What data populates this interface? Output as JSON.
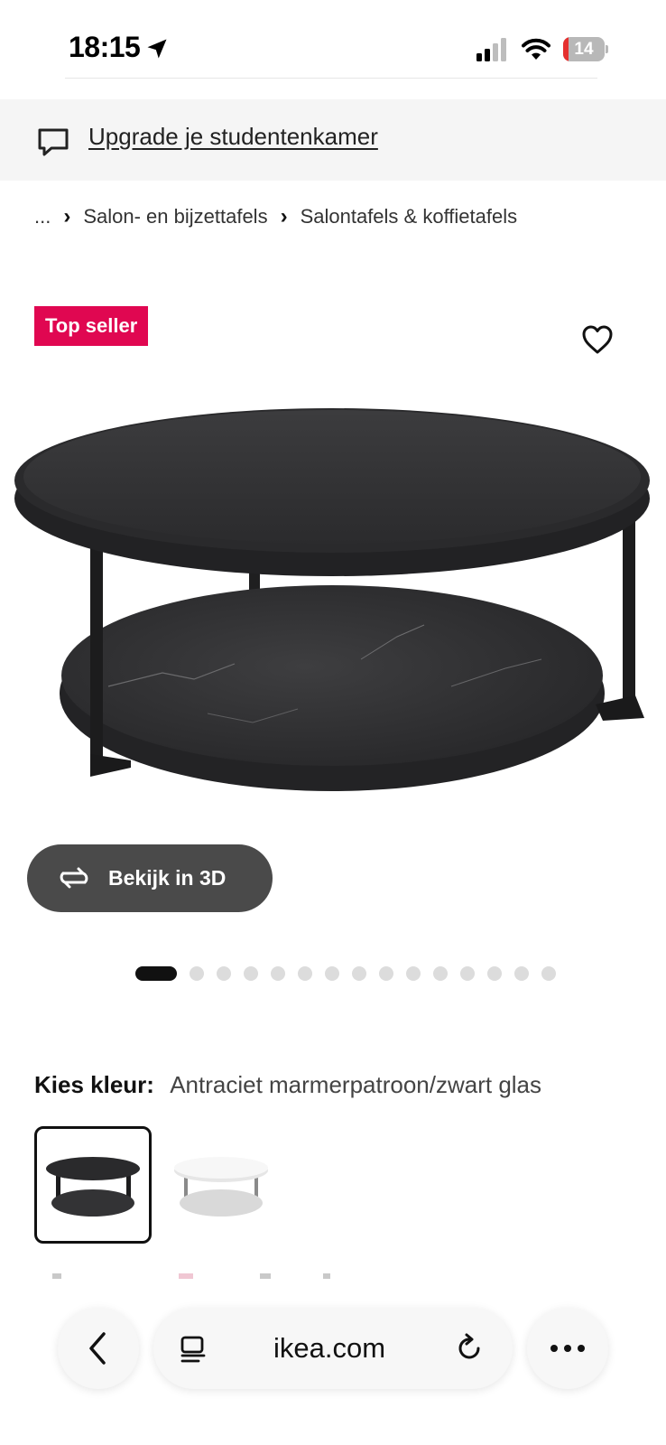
{
  "status_bar": {
    "time": "18:15",
    "battery_level": "14",
    "icons": [
      "location-arrow-icon",
      "cellular-signal-icon",
      "wifi-icon",
      "battery-icon"
    ]
  },
  "promo": {
    "icon": "chat-bubble-icon",
    "link_text": "Upgrade je studentenkamer"
  },
  "breadcrumb": {
    "items": [
      "...",
      "Salon- en bijzettafels",
      "Salontafels & koffietafels"
    ],
    "separator": "›"
  },
  "product": {
    "badge": "Top seller",
    "badge_color": "#e00751",
    "favorite_icon": "heart-icon",
    "view_3d_label": "Bekijk in 3D",
    "view_3d_icon": "rotate-3d-icon",
    "carousel": {
      "total_images": 15,
      "current_index": 1
    },
    "color_label": "Kies kleur:",
    "color_value": "Antraciet marmerpatroon/zwart glas",
    "swatches": [
      {
        "name": "antraciet",
        "selected": true
      },
      {
        "name": "wit",
        "selected": false
      }
    ]
  },
  "browser": {
    "url": "ikea.com",
    "icons": [
      "back-chevron-icon",
      "reader-mode-icon",
      "reload-icon",
      "more-icon"
    ]
  }
}
